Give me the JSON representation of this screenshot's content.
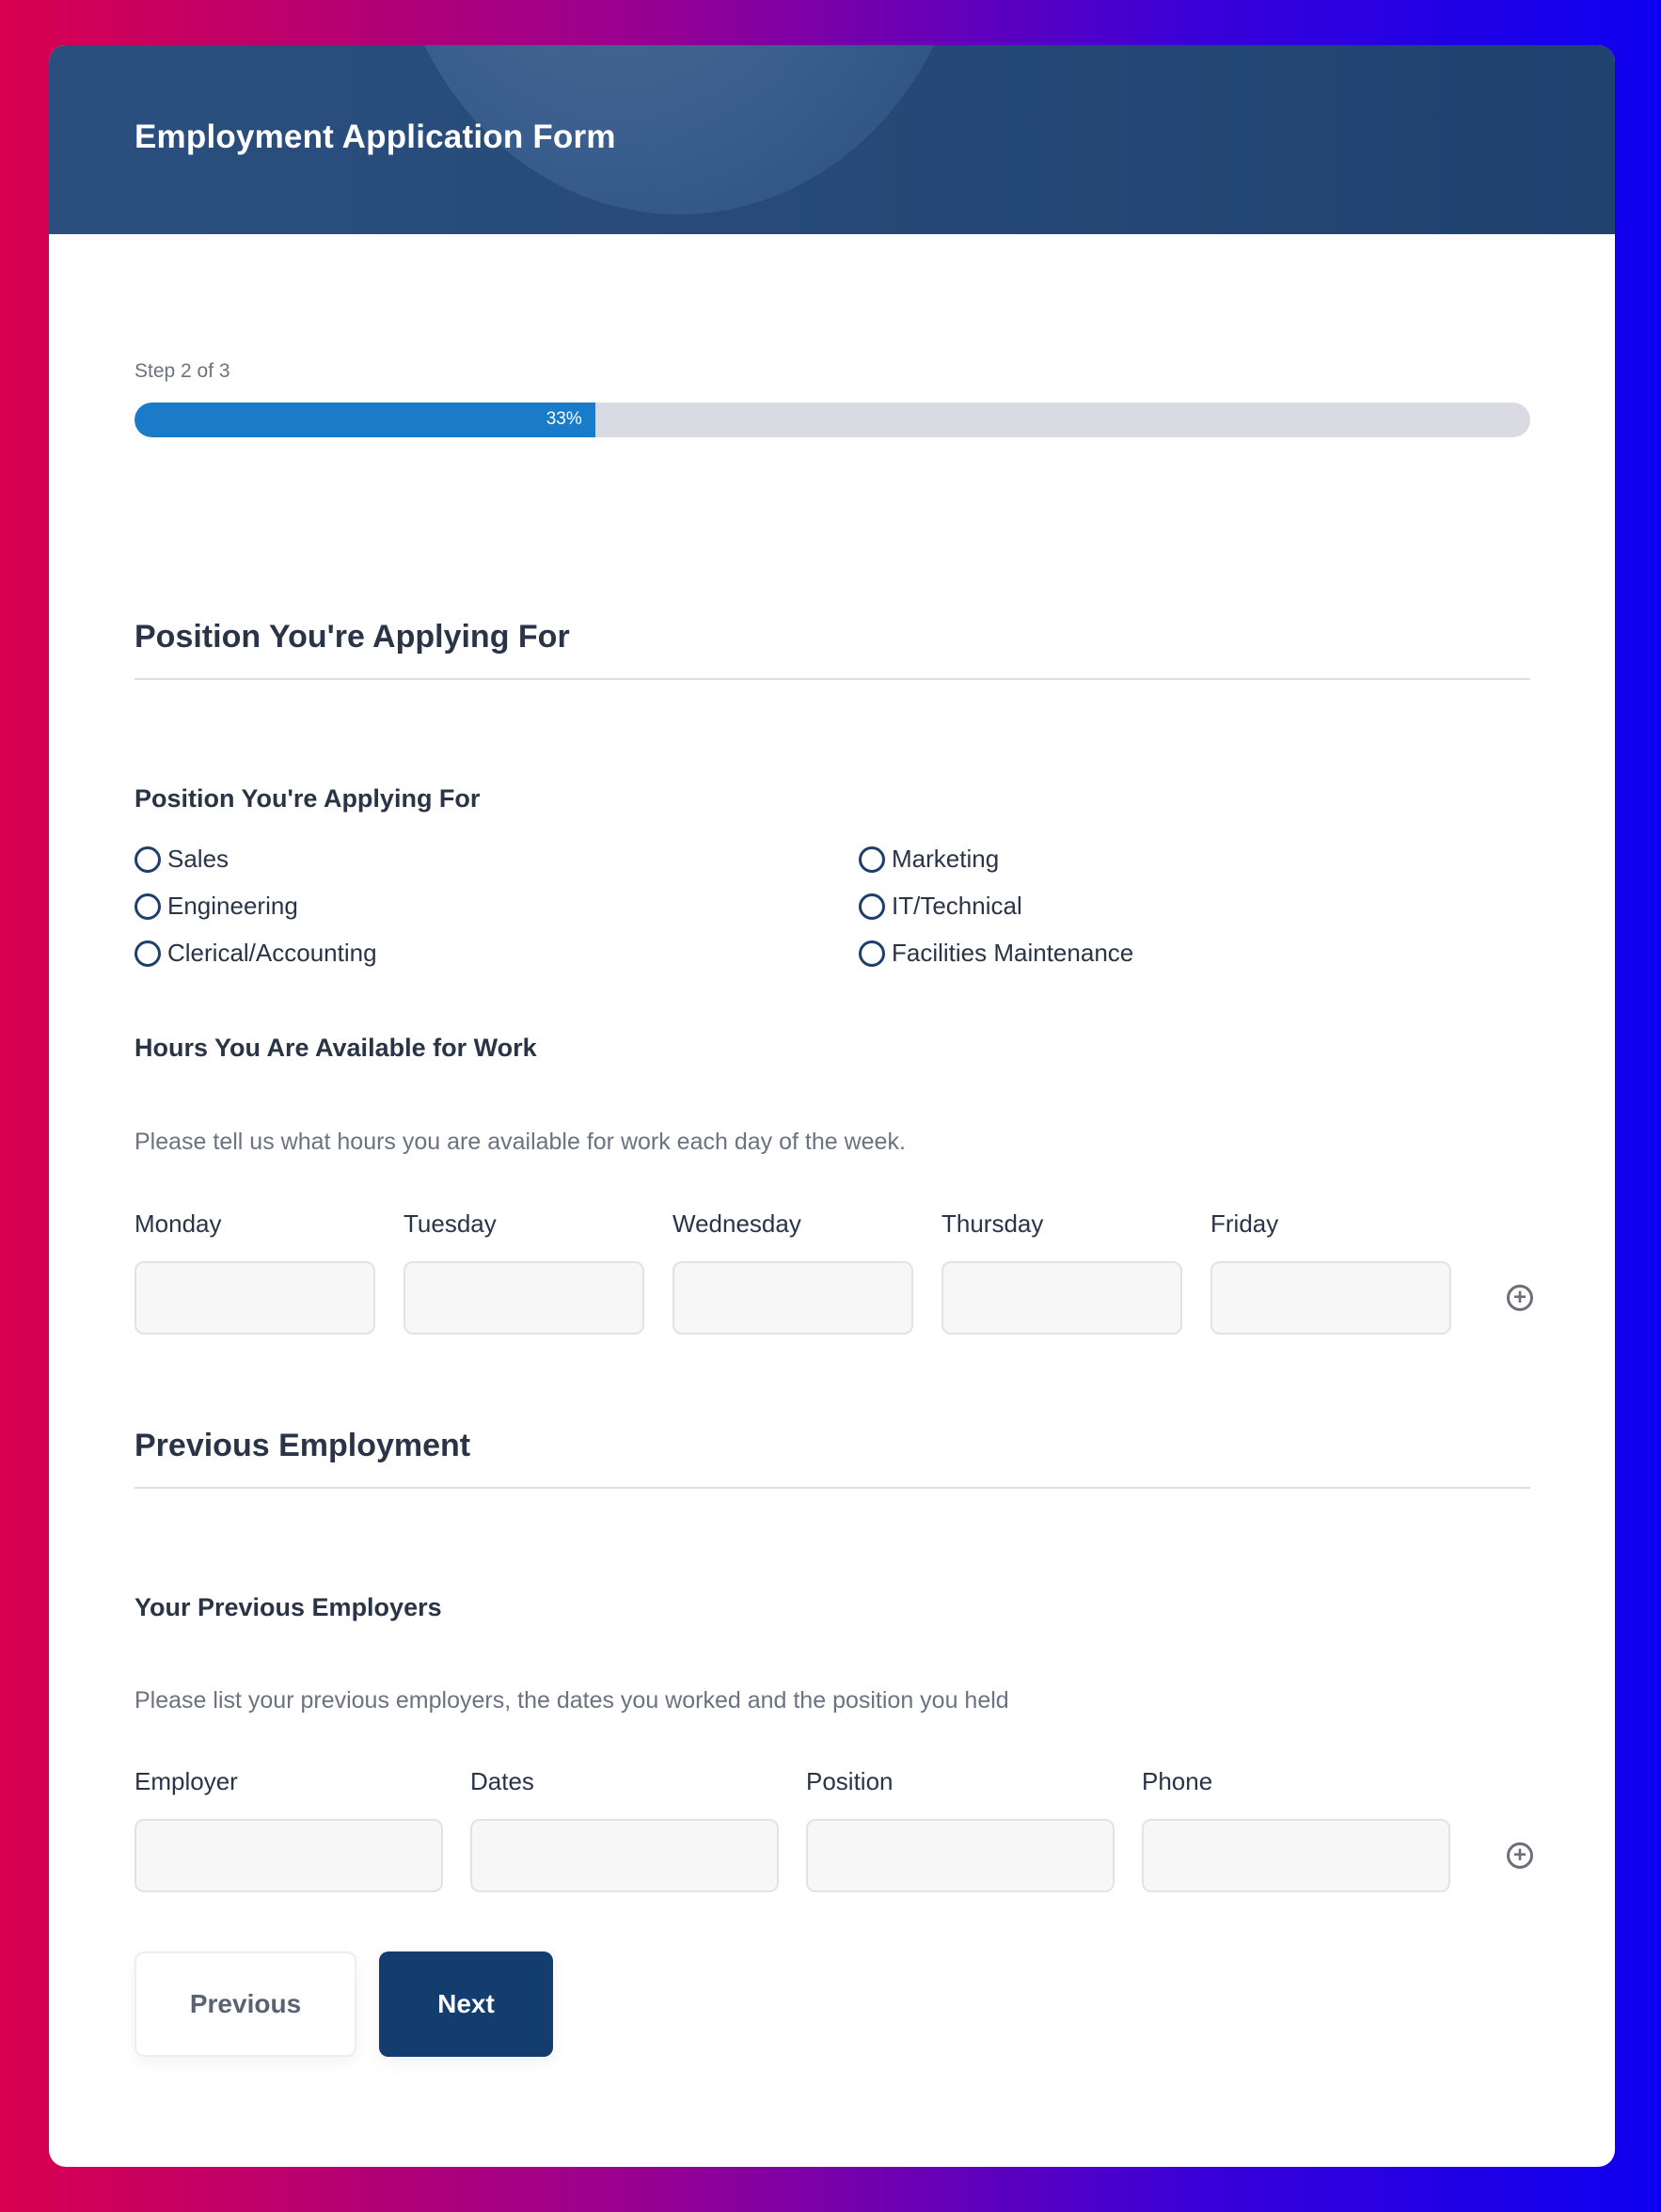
{
  "header": {
    "title": "Employment Application Form"
  },
  "progress": {
    "step_label": "Step 2 of 3",
    "percent_label": "33%",
    "percent": 33
  },
  "section_position": {
    "title": "Position You're Applying For",
    "field_label": "Position You're Applying For",
    "options": [
      "Sales",
      "Engineering",
      "Clerical/Accounting",
      "Marketing",
      "IT/Technical",
      "Facilities Maintenance"
    ]
  },
  "hours": {
    "label": "Hours You Are Available for Work",
    "help": "Please tell us what hours you are available for work each day of the week.",
    "columns": [
      "Monday",
      "Tuesday",
      "Wednesday",
      "Thursday",
      "Friday"
    ]
  },
  "section_previous": {
    "title": "Previous Employment",
    "field_label": "Your Previous Employers",
    "help": "Please list your previous employers, the dates you worked and the position you held",
    "columns": [
      "Employer",
      "Dates",
      "Position",
      "Phone"
    ]
  },
  "buttons": {
    "previous": "Previous",
    "next": "Next"
  },
  "colors": {
    "accent": "#1a7bc8",
    "header_bg": "#274a78",
    "next_button": "#123d6e"
  },
  "icons": {
    "add_row": "plus-circle-icon",
    "radio": "radio-circle-icon"
  }
}
